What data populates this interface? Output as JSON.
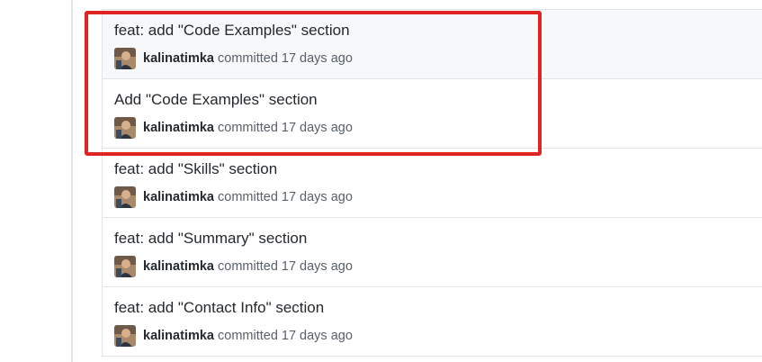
{
  "commits": [
    {
      "title": "feat: add \"Code Examples\" section",
      "author": "kalinatimka",
      "action": "committed",
      "time": "17 days ago"
    },
    {
      "title": "Add \"Code Examples\" section",
      "author": "kalinatimka",
      "action": "committed",
      "time": "17 days ago"
    },
    {
      "title": "feat: add \"Skills\" section",
      "author": "kalinatimka",
      "action": "committed",
      "time": "17 days ago"
    },
    {
      "title": "feat: add \"Summary\" section",
      "author": "kalinatimka",
      "action": "committed",
      "time": "17 days ago"
    },
    {
      "title": "feat: add \"Contact Info\" section",
      "author": "kalinatimka",
      "action": "committed",
      "time": "17 days ago"
    }
  ],
  "colors": {
    "annotation": "#e02424",
    "highlight_row": "#f6f8fa",
    "border": "#e1e4e8"
  },
  "icons": {
    "avatar": "user-avatar-photo"
  }
}
